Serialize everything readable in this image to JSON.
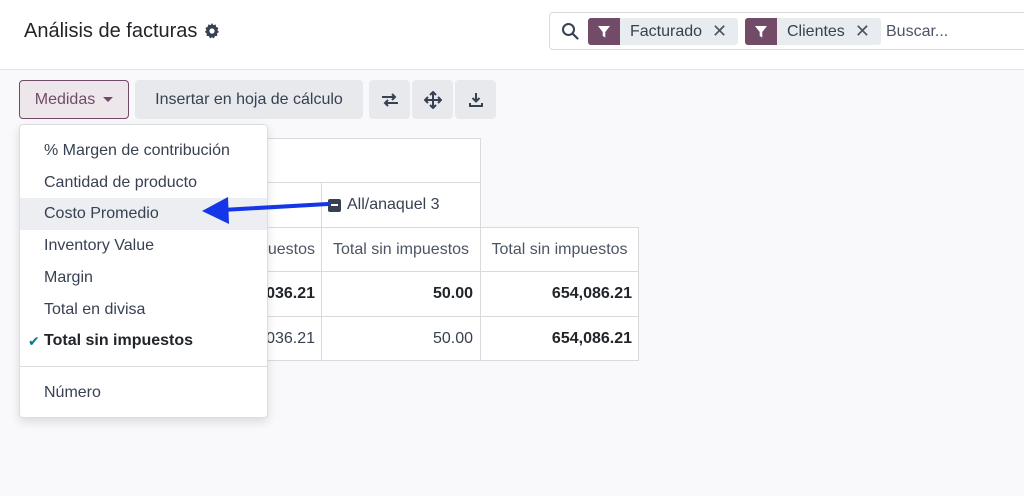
{
  "header": {
    "title": "Análisis de facturas",
    "settings_icon": "gear-icon"
  },
  "search": {
    "placeholder": "Buscar...",
    "facets": [
      {
        "label": "Facturado",
        "icon": "filter-icon"
      },
      {
        "label": "Clientes",
        "icon": "filter-icon"
      }
    ]
  },
  "toolbar": {
    "measures_label": "Medidas",
    "insert_label": "Insertar en hoja de cálculo",
    "flip_icon": "swap-axis-icon",
    "expand_icon": "expand-all-icon",
    "download_icon": "download-icon"
  },
  "pivot": {
    "col_group_label": "All/anaquel 3",
    "measure_headers": [
      "uestos",
      "Total sin impuestos",
      "Total sin impuestos"
    ],
    "rows": [
      {
        "partial": "036.21",
        "value": "50.00",
        "total": "654,086.21"
      },
      {
        "partial": "036.21",
        "value": "50.00",
        "total": "654,086.21"
      }
    ]
  },
  "measures_menu": {
    "items": [
      {
        "label": "% Margen de contribución",
        "selected": false
      },
      {
        "label": "Cantidad de producto",
        "selected": false
      },
      {
        "label": "Costo Promedio",
        "selected": false,
        "highlighted": true
      },
      {
        "label": "Inventory Value",
        "selected": false
      },
      {
        "label": "Margin",
        "selected": false
      },
      {
        "label": "Total en divisa",
        "selected": false
      },
      {
        "label": "Total sin impuestos",
        "selected": true
      }
    ],
    "extra_items": [
      {
        "label": "Número"
      }
    ]
  },
  "colors": {
    "brand": "#714b67",
    "check": "#017e84",
    "annotation_arrow": "#1436e6"
  }
}
